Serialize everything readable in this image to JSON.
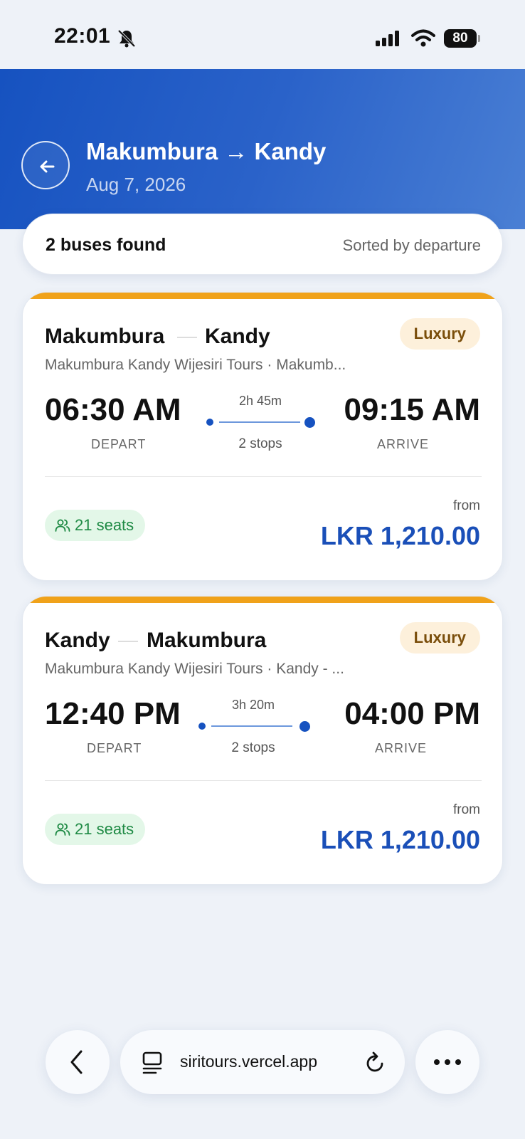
{
  "status_bar": {
    "time": "22:01",
    "battery": "80",
    "icons": [
      "bell-slash-icon",
      "signal-icon",
      "wifi-icon",
      "battery-icon"
    ]
  },
  "header": {
    "route": "Makumbura → Kandy",
    "date": "Aug 7, 2026",
    "back_icon": "arrow-left-icon"
  },
  "summary": {
    "count": "2 buses found",
    "sort": "Sorted by departure"
  },
  "results": [
    {
      "from": "Makumbura",
      "to": "Kandy",
      "class": "Luxury",
      "operator": "Makumbura Kandy Wijesiri Tours · Makumb...",
      "depart_time": "06:30 AM",
      "depart_label": "DEPART",
      "duration": "2h 45m",
      "stops": "2 stops",
      "arrive_time": "09:15 AM",
      "arrive_label": "ARRIVE",
      "seats": "21 seats",
      "from_label": "from",
      "price": "LKR 1,210.00"
    },
    {
      "from": "Kandy",
      "to": "Makumbura",
      "class": "Luxury",
      "operator": "Makumbura Kandy Wijesiri Tours · Kandy - ...",
      "depart_time": "12:40 PM",
      "depart_label": "DEPART",
      "duration": "3h 20m",
      "stops": "2 stops",
      "arrive_time": "04:00 PM",
      "arrive_label": "ARRIVE",
      "seats": "21 seats",
      "from_label": "from",
      "price": "LKR 1,210.00"
    }
  ],
  "browser_bar": {
    "url": "siritours.vercel.app",
    "icons": [
      "chevron-left-icon",
      "reader-icon",
      "reload-icon",
      "more-icon"
    ]
  },
  "colors": {
    "header_start": "#1652c0",
    "accent": "#f0a21a",
    "price": "#1a4fb8",
    "seats_bg": "#e3f7e8",
    "seats_text": "#1e8a44",
    "badge_bg": "#fdf0db",
    "badge_text": "#7a4e0b"
  }
}
